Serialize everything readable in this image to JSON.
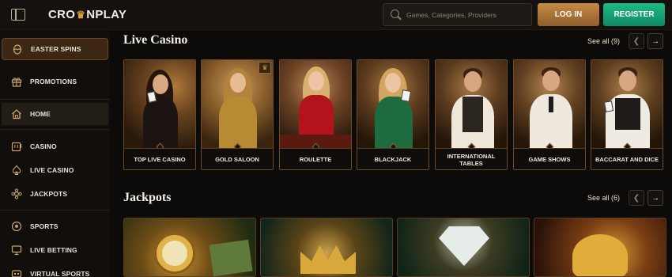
{
  "header": {
    "brand": {
      "pre": "CRO",
      "post": "NPLAY"
    },
    "search": {
      "placeholder": "Games, Categories, Providers"
    },
    "login_label": "LOG IN",
    "register_label": "REGISTER"
  },
  "sidebar": {
    "items": [
      {
        "label": "EASTER SPINS",
        "icon": "egg-icon"
      },
      {
        "label": "PROMOTIONS",
        "icon": "gift-icon"
      },
      {
        "label": "HOME",
        "icon": "home-icon"
      },
      {
        "label": "CASINO",
        "icon": "slot-machine-icon"
      },
      {
        "label": "LIVE CASINO",
        "icon": "spade-icon"
      },
      {
        "label": "JACKPOTS",
        "icon": "jackpot-icon"
      },
      {
        "label": "SPORTS",
        "icon": "soccer-ball-icon"
      },
      {
        "label": "LIVE BETTING",
        "icon": "live-betting-icon"
      },
      {
        "label": "VIRTUAL SPORTS",
        "icon": "virtual-sports-icon"
      }
    ]
  },
  "live_casino": {
    "title": "Live Casino",
    "see_all": "See all (9)",
    "cards": [
      {
        "label": "TOP LIVE CASINO"
      },
      {
        "label": "GOLD SALOON"
      },
      {
        "label": "ROULETTE"
      },
      {
        "label": "BLACKJACK"
      },
      {
        "label": "INTERNATIONAL TABLES"
      },
      {
        "label": "GAME SHOWS"
      },
      {
        "label": "BACCARAT AND DICE"
      }
    ]
  },
  "jackpots": {
    "title": "Jackpots",
    "see_all": "See all (6)"
  },
  "colors": {
    "accent_gold": "#c68a45",
    "register_green": "#1fb986",
    "background": "#0d0b09"
  }
}
